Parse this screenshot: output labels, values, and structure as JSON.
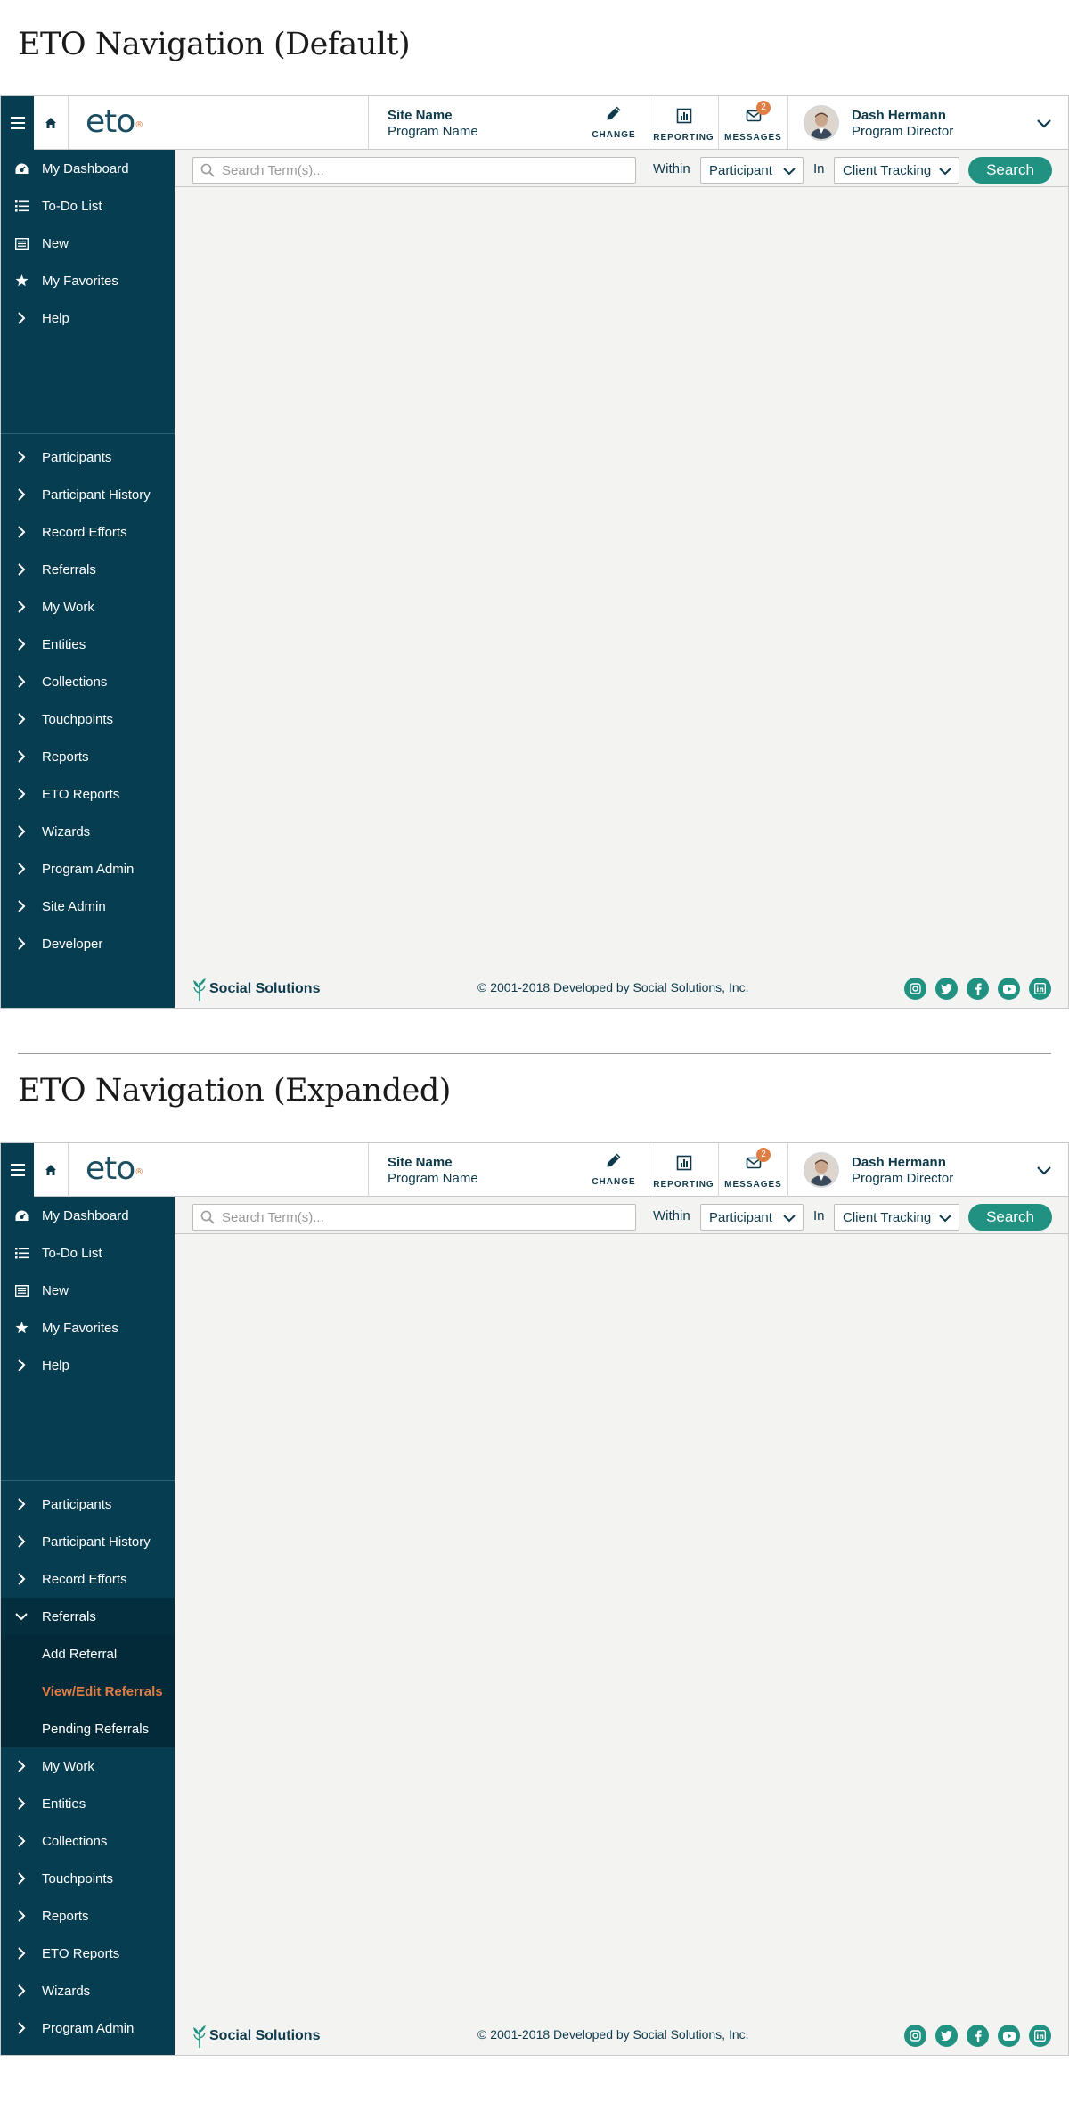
{
  "sections": [
    {
      "title": "ETO Navigation (Default)"
    },
    {
      "title": "ETO Navigation (Expanded)"
    }
  ],
  "header": {
    "logo": "eto",
    "logo_mark": "®",
    "site_name": "Site Name",
    "program_name": "Program Name",
    "change_label": "CHANGE",
    "reporting_label": "REPORTING",
    "messages_label": "MESSAGES",
    "messages_count": "2",
    "user_name": "Dash Hermann",
    "user_role": "Program Director"
  },
  "search": {
    "placeholder": "Search Term(s)...",
    "within_label": "Within",
    "within_value": "Participant",
    "in_label": "In",
    "in_value": "Client Tracking",
    "button_label": "Search"
  },
  "sidebar": {
    "top_items": [
      {
        "label": "My Dashboard",
        "icon": "dashboard-icon"
      },
      {
        "label": "To-Do List",
        "icon": "list-icon"
      },
      {
        "label": "New",
        "icon": "new-icon"
      },
      {
        "label": "My Favorites",
        "icon": "star-icon"
      },
      {
        "label": "Help",
        "icon": "chevron-right-icon"
      }
    ],
    "items": [
      "Participants",
      "Participant History",
      "Record Efforts",
      "Referrals",
      "My Work",
      "Entities",
      "Collections",
      "Touchpoints",
      "Reports",
      "ETO Reports",
      "Wizards",
      "Program Admin",
      "Site Admin",
      "Developer"
    ],
    "expanded_item": "Referrals",
    "sub_items": [
      "Add Referral",
      "View/Edit Referrals",
      "Pending Referrals"
    ],
    "active_sub_item": "View/Edit Referrals"
  },
  "footer": {
    "brand": "Social Solutions",
    "copyright": "© 2001-2018 Developed by Social Solutions, Inc.",
    "social_icons": [
      "instagram-icon",
      "twitter-icon",
      "facebook-icon",
      "youtube-icon",
      "linkedin-icon"
    ]
  },
  "colors": {
    "sidebar_bg": "#063d51",
    "sidebar_expanded_bg": "#032a38",
    "accent_orange": "#e07d45",
    "brand_green": "#219281",
    "content_bg": "#f3f3f2"
  }
}
